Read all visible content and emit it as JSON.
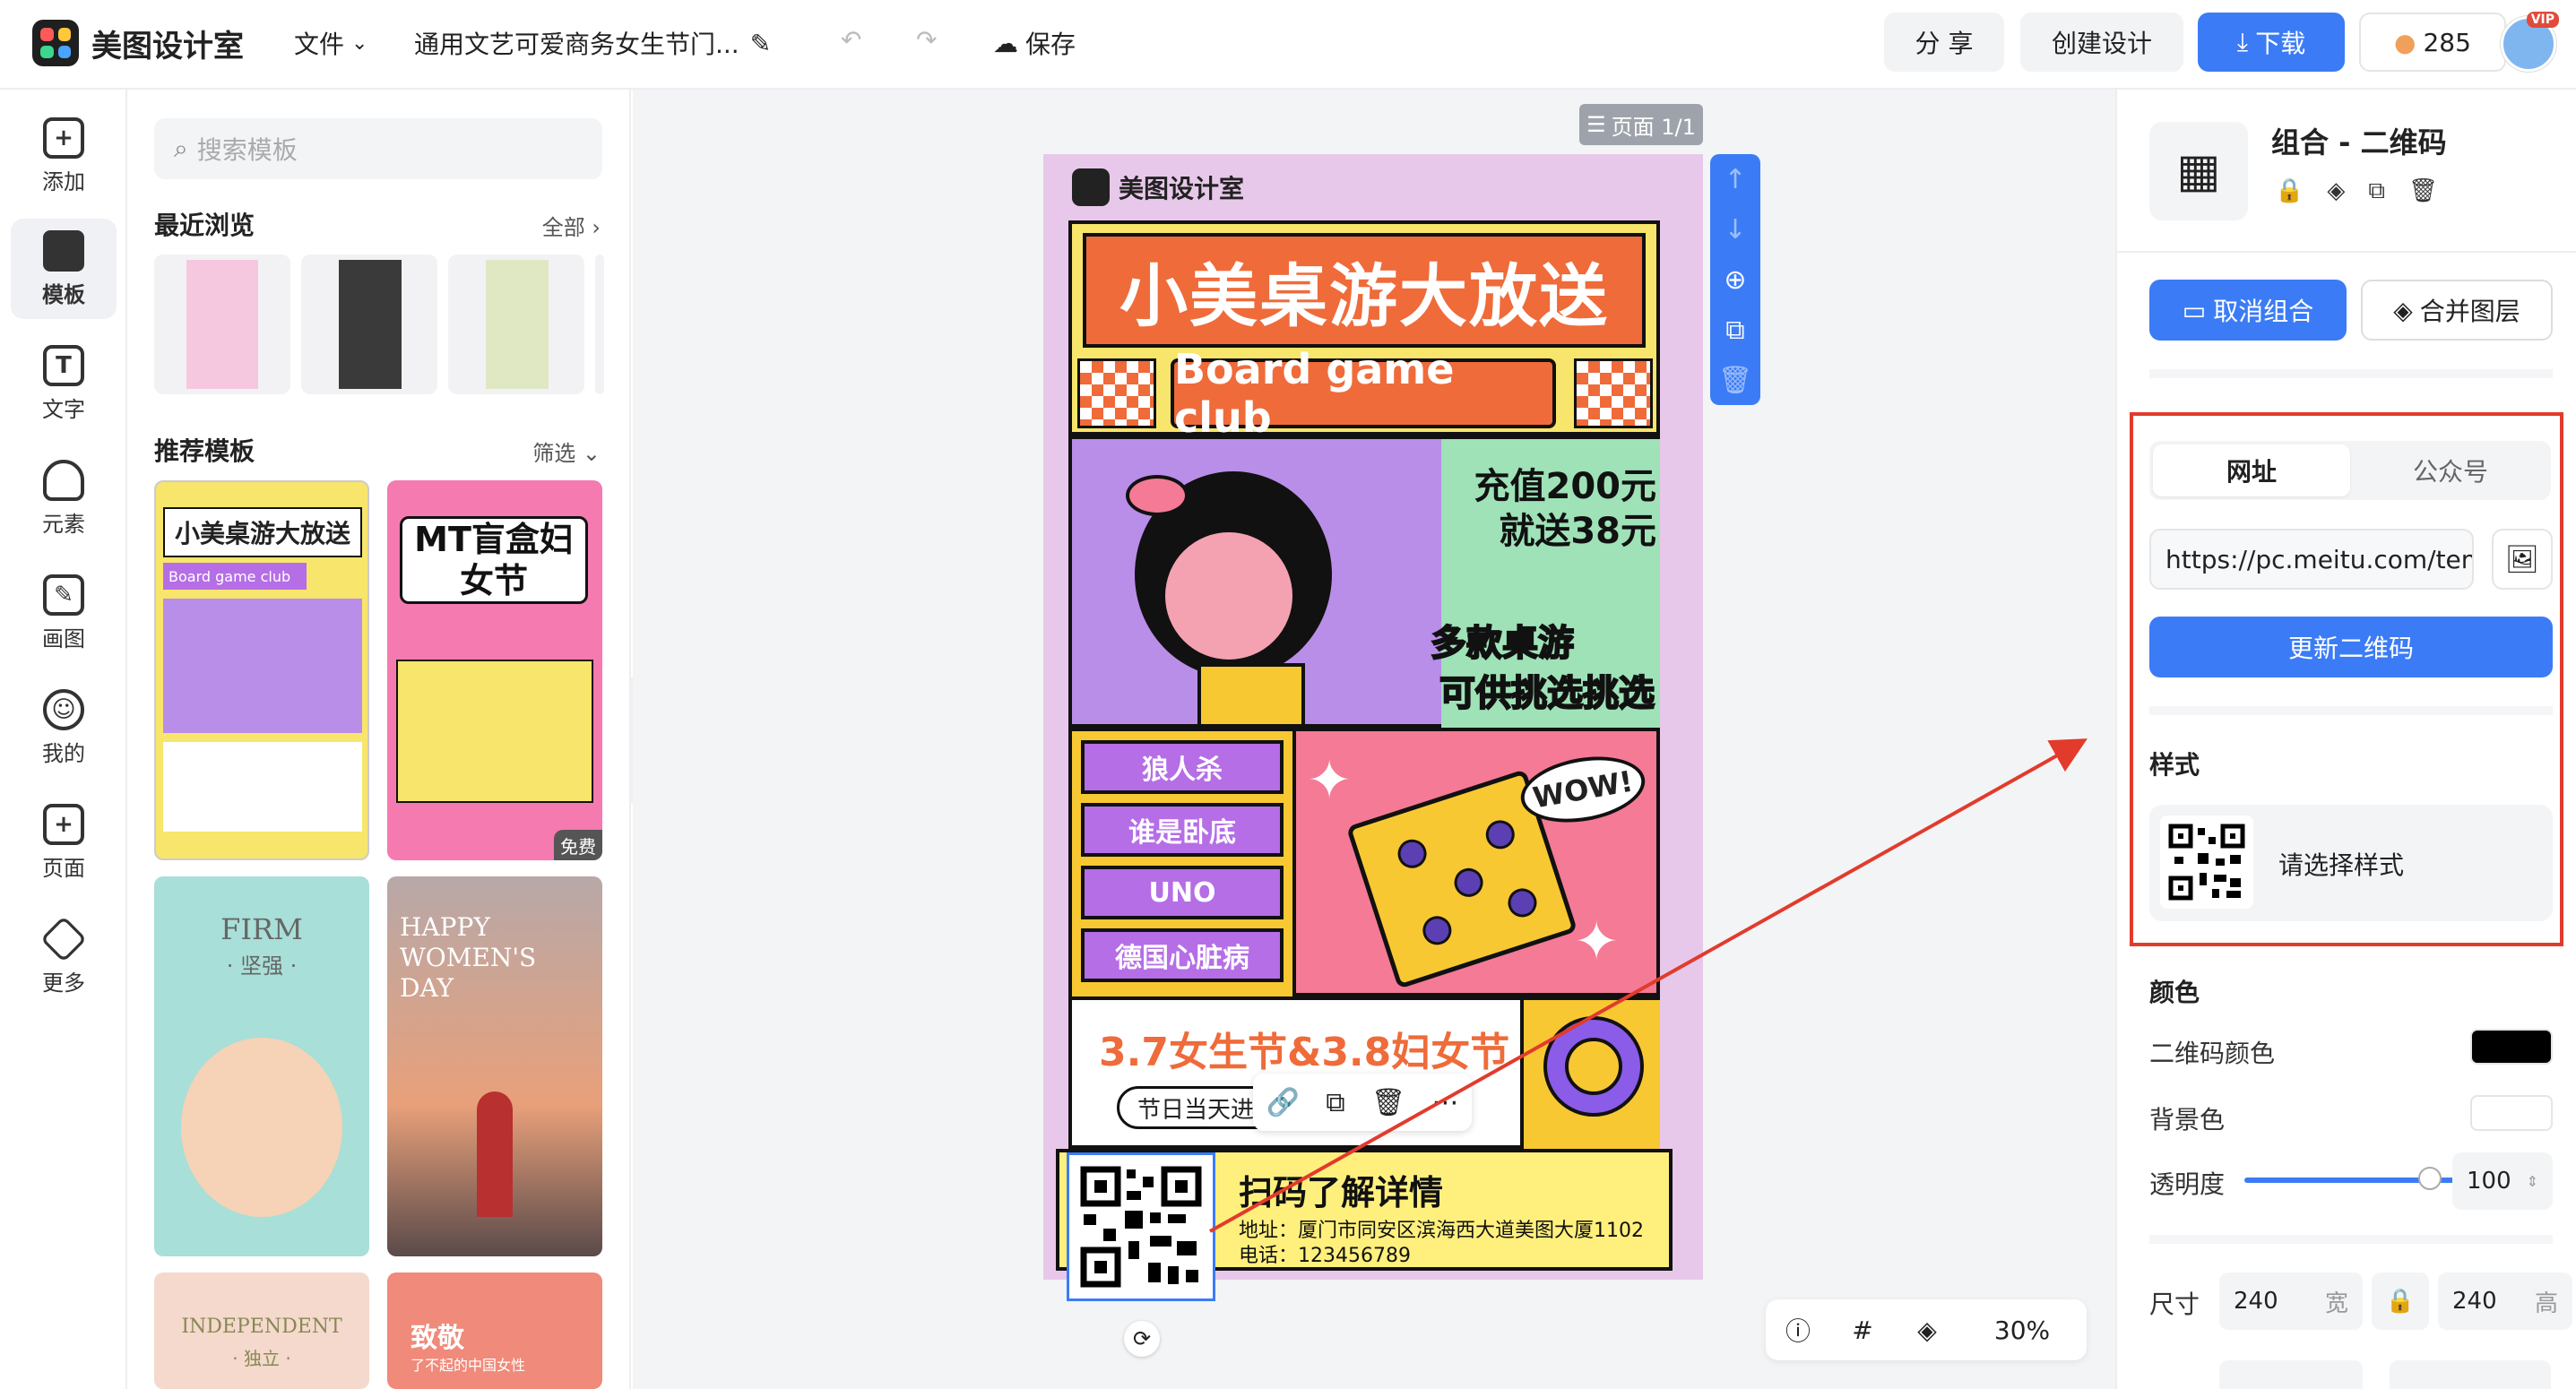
{
  "app": {
    "name": "美图设计室"
  },
  "toolbar": {
    "file_label": "文件",
    "doc_title": "通用文艺可爱商务女生节门...",
    "save_label": "保存",
    "share_label": "分 享",
    "create_label": "创建设计",
    "download_label": "下载",
    "points": "285",
    "vip_badge": "VIP"
  },
  "iconbar": {
    "items": [
      {
        "label": "添加",
        "icon": "plus-icon"
      },
      {
        "label": "模板",
        "icon": "template-icon"
      },
      {
        "label": "文字",
        "icon": "text-icon"
      },
      {
        "label": "元素",
        "icon": "shapes-icon"
      },
      {
        "label": "画图",
        "icon": "draw-icon"
      },
      {
        "label": "我的",
        "icon": "user-icon"
      },
      {
        "label": "页面",
        "icon": "page-icon"
      },
      {
        "label": "更多",
        "icon": "box-icon"
      }
    ]
  },
  "panel": {
    "search_placeholder": "搜索模板",
    "recent_title": "最近浏览",
    "recent_more": "全部",
    "recommend_title": "推荐模板",
    "recommend_filter": "筛选",
    "templates": [
      {
        "title": "小美桌游大放送",
        "sub": "Board game club"
      },
      {
        "title": "MT盲盒妇女节",
        "badge": "免费"
      },
      {
        "title": "FIRM",
        "sub": "· 坚强 ·"
      },
      {
        "title": "HAPPY WOMEN'S DAY"
      },
      {
        "title": "INDEPENDENT",
        "sub": "· 独立 ·"
      },
      {
        "title": "致敬",
        "sub": "了不起的中国女性"
      }
    ]
  },
  "canvas": {
    "page_indicator": "页面 1/1",
    "zoom": "30%"
  },
  "poster": {
    "brand": "美图设计室",
    "title": "小美桌游大放送",
    "subtitle": "Board game club",
    "promo_line1": "充值200元",
    "promo_line2": "就送38元",
    "games_line1": "多款桌游",
    "games_line2": "可供挑选挑选",
    "games": [
      "狼人杀",
      "谁是卧底",
      "UNO",
      "德国心脏病"
    ],
    "wow": "WOW!",
    "event_title": "3.7女生节&3.8妇女节",
    "event_note": "节日当天进店",
    "footer_title": "扫码了解详情",
    "address": "地址：厦门市同安区滨海西大道美图大厦1102",
    "phone": "电话：123456789"
  },
  "right_panel": {
    "header_title": "组合 - 二维码",
    "ungroup_label": "取消组合",
    "merge_label": "合并图层",
    "tab_url": "网址",
    "tab_official": "公众号",
    "url_value": "https://pc.meitu.com/temp",
    "update_label": "更新二维码",
    "style_title": "样式",
    "style_choose": "请选择样式",
    "color_title": "颜色",
    "qr_color_label": "二维码颜色",
    "bg_color_label": "背景色",
    "opacity_label": "透明度",
    "opacity_value": "100",
    "size_label": "尺寸",
    "width_value": "240",
    "width_unit": "宽",
    "height_value": "240",
    "height_unit": "高",
    "qr_color": "#000000",
    "bg_color": "#ffffff"
  },
  "colors": {
    "accent": "#3b7cf6",
    "highlight": "#e23b2c"
  }
}
